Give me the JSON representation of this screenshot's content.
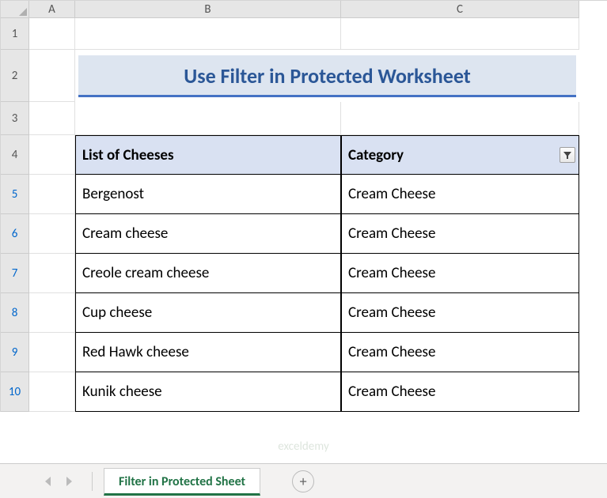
{
  "columns": [
    "A",
    "B",
    "C"
  ],
  "rows": [
    {
      "n": "1",
      "filtered": false
    },
    {
      "n": "2",
      "filtered": false
    },
    {
      "n": "3",
      "filtered": false
    },
    {
      "n": "4",
      "filtered": false
    },
    {
      "n": "5",
      "filtered": true
    },
    {
      "n": "6",
      "filtered": true
    },
    {
      "n": "7",
      "filtered": true
    },
    {
      "n": "8",
      "filtered": true
    },
    {
      "n": "9",
      "filtered": true
    },
    {
      "n": "10",
      "filtered": true
    }
  ],
  "title": "Use Filter in Protected Worksheet",
  "headers": {
    "col_b": "List of Cheeses",
    "col_c": "Category"
  },
  "table": [
    {
      "b": "Bergenost",
      "c": "Cream Cheese"
    },
    {
      "b": "Cream cheese",
      "c": "Cream Cheese"
    },
    {
      "b": "Creole cream cheese",
      "c": "Cream Cheese"
    },
    {
      "b": "Cup cheese",
      "c": "Cream Cheese"
    },
    {
      "b": "Red Hawk cheese",
      "c": "Cream Cheese"
    },
    {
      "b": "Kunik cheese",
      "c": "Cream Cheese"
    }
  ],
  "tab": {
    "label": "Filter in Protected Sheet"
  },
  "icons": {
    "filter": "filter-active-icon",
    "plus": "+"
  },
  "watermark": "exceldemy"
}
